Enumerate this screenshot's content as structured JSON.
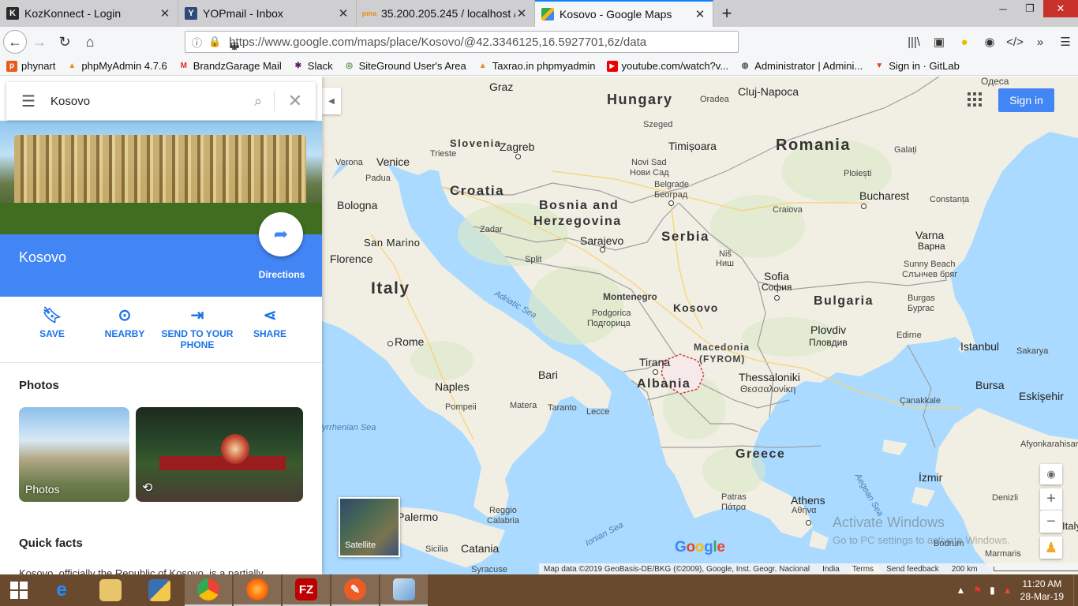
{
  "browser": {
    "tabs": [
      {
        "title": "KozKonnect - Login",
        "icon": "kozkonnect-favicon",
        "active": false
      },
      {
        "title": "YOPmail - Inbox",
        "icon": "yopmail-favicon",
        "active": false
      },
      {
        "title": "35.200.205.245 / localhost /",
        "icon": "phpmyadmin-favicon",
        "active": false
      },
      {
        "title": "Kosovo - Google Maps",
        "icon": "google-maps-favicon",
        "active": true
      }
    ],
    "url": "https://www.google.com/maps/place/Kosovo/@42.3346125,16.5927701,6z/data",
    "bookmarks": [
      {
        "label": "phynart",
        "icon": "phynart-icon"
      },
      {
        "label": "phpMyAdmin 4.7.6",
        "icon": "phpmyadmin-icon"
      },
      {
        "label": "BrandzGarage Mail",
        "icon": "gmail-icon"
      },
      {
        "label": "Slack",
        "icon": "slack-icon"
      },
      {
        "label": "SiteGround User's Area",
        "icon": "siteground-icon"
      },
      {
        "label": "Taxrao.in phpmyadmin",
        "icon": "phpmyadmin-icon"
      },
      {
        "label": "youtube.com/watch?v...",
        "icon": "youtube-icon"
      },
      {
        "label": "Administrator | Admini...",
        "icon": "globe-icon"
      },
      {
        "label": "Sign in · GitLab",
        "icon": "gitlab-icon"
      }
    ]
  },
  "panel": {
    "search_value": "Kosovo",
    "place_name": "Kosovo",
    "directions_label": "Directions",
    "actions": [
      {
        "label": "SAVE",
        "icon": "bookmark-icon"
      },
      {
        "label": "NEARBY",
        "icon": "location-pin-icon"
      },
      {
        "label": "SEND TO YOUR PHONE",
        "icon": "send-to-phone-icon"
      },
      {
        "label": "SHARE",
        "icon": "share-icon"
      }
    ],
    "photos_heading": "Photos",
    "photo_label": "Photos",
    "quick_facts_heading": "Quick facts",
    "quick_facts_text": "Kosovo, officially the Republic of Kosovo, is a partially"
  },
  "map": {
    "sign_in": "Sign in",
    "satellite_label": "Satellite",
    "google_logo": "Google",
    "labels": {
      "countries": [
        "Hungary",
        "Romania",
        "Slovenia",
        "Croatia",
        "Bosnia and",
        "Herzegovina",
        "Serbia",
        "Italy",
        "Montenegro",
        "Kosovo",
        "Macedonia",
        "(FYROM)",
        "Albania",
        "Bulgaria",
        "Greece"
      ],
      "cities": [
        "Graz",
        "Cluj-Napoca",
        "Одеса",
        "Zagreb",
        "Timișoara",
        "Venice",
        "Verona",
        "Padua",
        "Trieste",
        "Szeged",
        "Oradea",
        "Novi Sad",
        "Нови Сад",
        "Belgrade",
        "Београд",
        "Ploiești",
        "Galați",
        "Bucharest",
        "Constanța",
        "Craiova",
        "Bologna",
        "San Marino",
        "Florence",
        "Zadar",
        "Sarajevo",
        "Split",
        "Niš",
        "Ниш",
        "Varna",
        "Варна",
        "Sunny Beach",
        "Слънчев бряг",
        "Sofia",
        "София",
        "Burgas",
        "Бургас",
        "Podgorica",
        "Подгорица",
        "Rome",
        "Plovdiv",
        "Пловдив",
        "Edirne",
        "Istanbul",
        "Sakarya",
        "Tirana",
        "Thessaloniki",
        "Θεσσαλονίκη",
        "Bari",
        "Naples",
        "Pompeii",
        "Matera",
        "Taranto",
        "Lecce",
        "Bursa",
        "Eskişehir",
        "Çanakkale",
        "Afyonkarahisar",
        "İzmir",
        "Denizli",
        "Patras",
        "Πάτρα",
        "Athens",
        "Αθήνα",
        "Reggio",
        "Calabria",
        "Palermo",
        "Catania",
        "Sicilia",
        "Syracuse",
        "Bodrum",
        "Marmaris",
        "Italy"
      ],
      "seas": [
        "Adriatic Sea",
        "Tyrrhenian Sea",
        "Ionian Sea",
        "Aegean Sea"
      ]
    },
    "footer": [
      "Map data ©2019 GeoBasis-DE/BKG (©2009), Google, Inst. Geogr. Nacional",
      "India",
      "Terms",
      "Send feedback",
      "200 km"
    ],
    "watermark_title": "Activate Windows",
    "watermark_sub": "Go to PC settings to activate Windows."
  },
  "taskbar": {
    "apps": [
      "internet-explorer-icon",
      "file-explorer-icon",
      "python-icon",
      "chrome-icon",
      "firefox-icon",
      "filezilla-icon",
      "postman-icon",
      "virtualbox-icon"
    ],
    "time": "11:20 AM",
    "date": "28-Mar-19"
  },
  "colors": {
    "accent": "#4285f4",
    "water": "#aadaff",
    "land": "#f2efe4",
    "taskbar": "#6a4a2e"
  }
}
